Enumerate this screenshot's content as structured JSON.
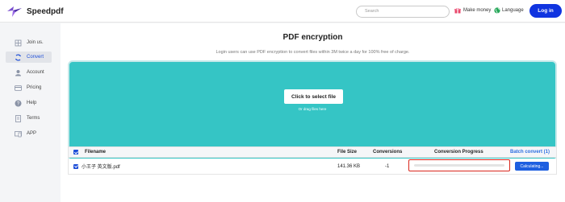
{
  "header": {
    "brand": "Speedpdf",
    "search_placeholder": "Search",
    "make_money": "Make money",
    "language": "Language",
    "login": "Log in"
  },
  "sidebar": {
    "items": [
      {
        "label": "Join us.",
        "icon": "join-icon"
      },
      {
        "label": "Convert",
        "icon": "convert-icon",
        "active": true
      },
      {
        "label": "Account",
        "icon": "account-icon"
      },
      {
        "label": "Pricing",
        "icon": "pricing-icon"
      },
      {
        "label": "Help",
        "icon": "help-icon"
      },
      {
        "label": "Terms",
        "icon": "terms-icon"
      },
      {
        "label": "APP",
        "icon": "app-icon"
      }
    ]
  },
  "main": {
    "title": "PDF encryption",
    "subtitle": "Login users can use PDF encryption to convert files within 3M twice a day for 100% free of charge.",
    "select_button": "Click to select file",
    "drop_hint": "Or drag files here"
  },
  "table": {
    "headers": {
      "filename": "Filename",
      "file_size": "File Size",
      "conversions": "Conversions",
      "progress": "Conversion Progress",
      "batch": "Batch convert (1)"
    },
    "rows": [
      {
        "filename": "小王子 英文版.pdf",
        "file_size": "141.36 KB",
        "conversions": "-1",
        "progress": 0,
        "status": "Calculating..."
      }
    ]
  },
  "colors": {
    "primary": "#1034e0",
    "dropzone": "#35c5c5",
    "highlight": "#d9261c"
  }
}
